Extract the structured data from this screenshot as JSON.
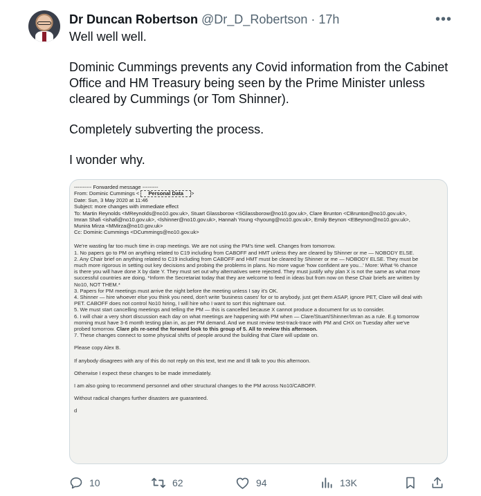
{
  "author": {
    "name": "Dr Duncan Robertson",
    "handle": "@Dr_D_Robertson",
    "separator": "·",
    "time": "17h"
  },
  "tweet": {
    "paragraphs": [
      "Well well well.",
      "Dominic Cummings prevents any Covid information from the Cabinet Office and HM Treasury being seen by the Prime Minister unless cleared by Cummings (or Tom Shinner).",
      "Completely subverting the process.",
      "I wonder why."
    ]
  },
  "email": {
    "forwarded": "---------- Forwarded message ---------",
    "from_label": "From: Dominic Cummings <",
    "personal_data": "Personal Data",
    "from_end": ">",
    "date": "Date: Sun, 3 May 2020 at 11:46",
    "subject": "Subject: more changes with immediate effect",
    "to_line1": "To: Martin Reynolds <MReynolds@no10.gov.uk>, Stuart Glassborow <SGlassborow@no10.gov.uk>, Clare Brunton <CBrunton@no10.gov.uk>,",
    "to_line2": "Imran Shafi <ishafi@no10.gov.uk>, <lshinner@no10.gov.uk>, Hannah Young <hyoung@no10.gov.uk>, Emily Beynon <EBeynon@no10.gov.uk>,",
    "to_line3": "Munira Mirza <MMirza@no10.gov.uk>",
    "cc": "Cc: Dominic Cummings <DCummings@no10.gov.uk>",
    "body": [
      "We're wasting far too much time in crap meetings. We are not using the PM's time well. Changes from tomorrow.",
      "1. No papers go to PM on anything related to C19 including from CABOFF and HMT unless they are cleared by Shinner or me — NOBODY ELSE.",
      "2. Any Chair brief on anything related to C19 including from CABOFF and HMT must be cleared by Shinner or me — NOBODY ELSE. They must be",
      "much more rigorous in setting out key decisions and probing the problems in plans. No more vague 'how confident are you...' More: What % chance",
      "is there you will have done X by date Y. They must set out why alternatives were rejected. They must justify why plan X is not the same as what more",
      "successful countries are doing. *Inform the Secretariat today that they are welcome to feed in ideas but from now on these Chair briefs are written by",
      "No10, NOT THEM.*",
      "3. Papers for PM meetings must arrive the night before the meeting unless I say it's OK.",
      "4. Shinner — hire whoever else you think you need, don't write 'business cases' for or to anybody, just get them ASAP, ignore PET, Clare will deal with",
      "PET. CABOFF does not control No10 hiring, I will hire who I want to sort this nightmare out.",
      "5. We must start cancelling meetings and telling the PM — this is cancelled because X cannot produce a document for us to consider.",
      "6. I will chair a very short discussion each day on what meetings are happening with PM when — Clare/Stuart/Shinner/Imran as a rule. E.g tomorrow",
      "morning must have 3-6 month testing plan in, as per PM demand. And we must review test-track-trace with PM and CHX on Tuesday after we've",
      "probed tomorrow.",
      "7. These changes connect to some physical shifts of people around the building that Clare will update on."
    ],
    "item6_bold": "Clare pls re-send the forward look to this group of 5. All to review this afternoon.",
    "tail": [
      "Please copy Alex B.",
      "If anybody disagrees with any of this do not reply on this text, text me and Ill talk to you this afternoon.",
      "Otherwise I expect these changes to be made immediately.",
      "I am also going to recommend personnel and other structural changes to the PM across No10/CABOFF.",
      "Without radical changes further disasters are guaranteed.",
      "d"
    ]
  },
  "actions": {
    "replies": "10",
    "retweets": "62",
    "likes": "94",
    "views": "13K"
  },
  "colors": {
    "text": "#0f1419",
    "muted": "#536471",
    "link": "#1a3fb5"
  },
  "icons": [
    "more-icon",
    "reply-icon",
    "retweet-icon",
    "like-icon",
    "views-icon",
    "bookmark-icon",
    "share-icon"
  ]
}
